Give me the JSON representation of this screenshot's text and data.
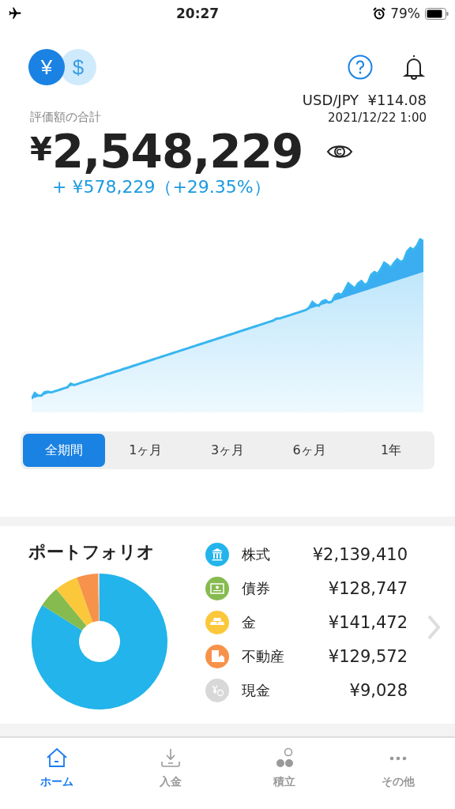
{
  "status_bar": {
    "time": "20:27",
    "battery": "79%"
  },
  "header": {
    "currency_toggle": [
      {
        "symbol": "¥",
        "selected": true
      },
      {
        "symbol": "$",
        "selected": false
      }
    ]
  },
  "fx": {
    "pair": "USD/JPY",
    "rate": "¥114.08",
    "timestamp": "2021/12/22 1:00"
  },
  "total": {
    "label": "評価額の合計",
    "currency": "¥",
    "amount": "2,548,229",
    "change": "+ ¥578,229（+29.35%）"
  },
  "periods": [
    {
      "label": "全期間",
      "selected": true
    },
    {
      "label": "1ヶ月",
      "selected": false
    },
    {
      "label": "3ヶ月",
      "selected": false
    },
    {
      "label": "6ヶ月",
      "selected": false
    },
    {
      "label": "1年",
      "selected": false
    }
  ],
  "portfolio": {
    "title": "ポートフォリオ",
    "chart_data": {
      "type": "donut",
      "categories": [
        "株式",
        "債券",
        "金",
        "不動産",
        "現金"
      ],
      "values": [
        83.97,
        5.05,
        5.55,
        5.08,
        0.35
      ]
    },
    "items": [
      {
        "kind": "stock",
        "value": "¥2,139,410",
        "color": "#22b4ea"
      },
      {
        "kind": "bond",
        "value": "¥128,747",
        "color": "#86bb50"
      },
      {
        "kind": "bullion",
        "value": "¥141,472",
        "color": "#fbc83c"
      },
      {
        "kind": "realestate",
        "value": "¥129,572",
        "color": "#f7924a"
      },
      {
        "kind": "cash",
        "value": "¥9,028",
        "color": "#d8d8d8"
      }
    ]
  },
  "tab_bar": [
    {
      "kind": "home",
      "label": "ホーム",
      "selected": true
    },
    {
      "kind": "deposit",
      "label": "入金",
      "selected": false
    },
    {
      "kind": "savings",
      "label": "積立",
      "selected": false
    },
    {
      "kind": "more",
      "label": "その他",
      "selected": false
    }
  ]
}
